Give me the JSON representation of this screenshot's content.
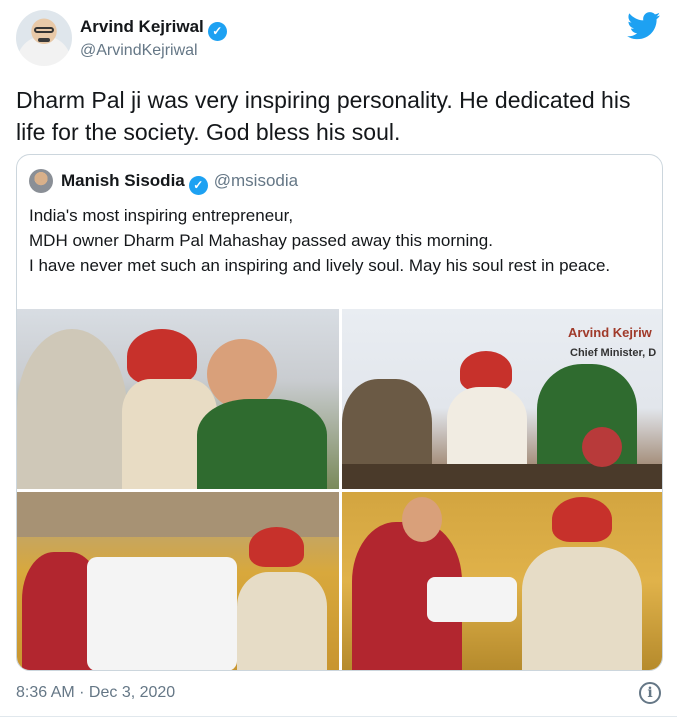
{
  "author": {
    "name": "Arvind Kejriwal",
    "handle": "@ArvindKejriwal",
    "verified_icon": "verified-badge-icon",
    "verified_glyph": "✓"
  },
  "brand": {
    "icon": "twitter-bird-icon",
    "color": "#1da1f2"
  },
  "tweet": {
    "text": "Dharm Pal ji was very inspiring personality. He dedicated his life for the society. God bless his soul."
  },
  "quoted_tweet": {
    "name": "Manish Sisodia",
    "handle": "@msisodia",
    "lines": [
      "India's most inspiring entrepreneur,",
      "MDH owner Dharm Pal Mahashay passed away this morning.",
      "I have never met such an inspiring and lively soul. May his soul rest in peace."
    ],
    "photo_banner": {
      "title": "Arvind Kejriw",
      "subtitle": "Chief Minister, D"
    }
  },
  "footer": {
    "timestamp": "8:36 AM · Dec 3, 2020",
    "info_icon": "info-icon",
    "info_glyph": "i"
  },
  "colors": {
    "text": "#14171a",
    "secondary": "#657786",
    "border": "#ccd6dd"
  }
}
